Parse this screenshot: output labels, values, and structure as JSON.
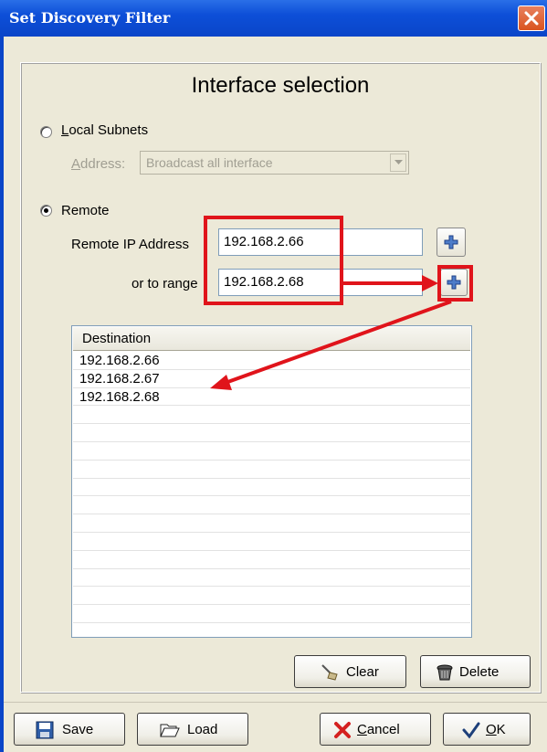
{
  "window": {
    "title": "Set Discovery Filter"
  },
  "heading": "Interface selection",
  "local_subnets": {
    "label": "Local Subnets",
    "selected": false,
    "address_label": "Address:",
    "address_value": "Broadcast all interface"
  },
  "remote": {
    "label": "Remote",
    "selected": true,
    "ip_label": "Remote IP Address",
    "ip_value": "192.168.2.66",
    "range_label": "or to range",
    "range_value": "192.168.2.68"
  },
  "destination": {
    "header": "Destination",
    "rows": [
      "192.168.2.66",
      "192.168.2.67",
      "192.168.2.68"
    ]
  },
  "buttons": {
    "clear": "Clear",
    "delete": "Delete",
    "save": "Save",
    "load": "Load",
    "cancel": "Cancel",
    "ok": "OK"
  },
  "annotation_color": "#e0141b"
}
